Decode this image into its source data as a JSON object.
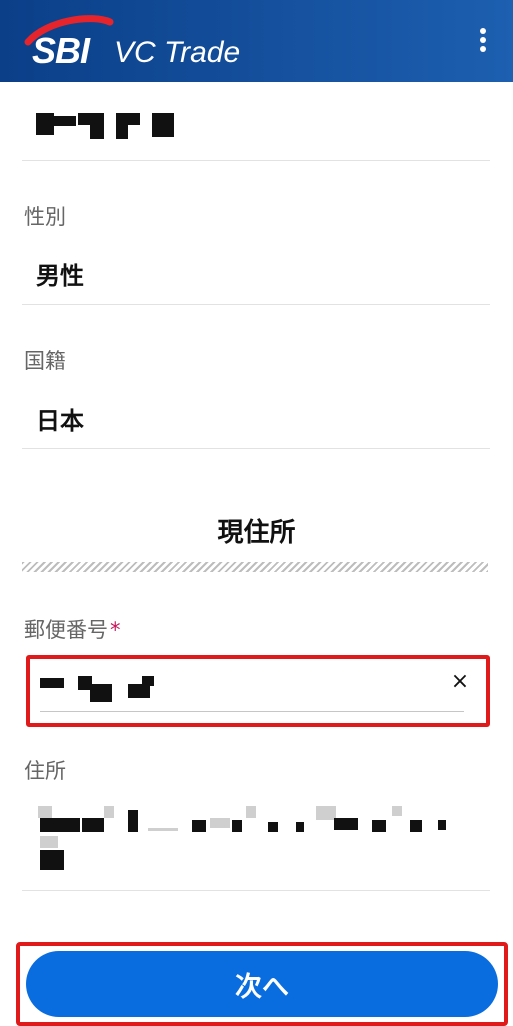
{
  "header": {
    "logo_sbi": "SBI",
    "logo_vc": "VC Trade",
    "brand_color": "#0b3f88",
    "menu_icon": "more-vertical-icon"
  },
  "fields": {
    "gender_label": "性別",
    "gender_value": "男性",
    "nationality_label": "国籍",
    "nationality_value": "日本"
  },
  "address_section": {
    "title": "現住所",
    "postal_label": "郵便番号",
    "required_mark": "*",
    "clear_icon": "×",
    "address_label": "住所"
  },
  "actions": {
    "next_label": "次へ",
    "button_color": "#0a6ddf",
    "highlight_color": "#e01a1a"
  }
}
